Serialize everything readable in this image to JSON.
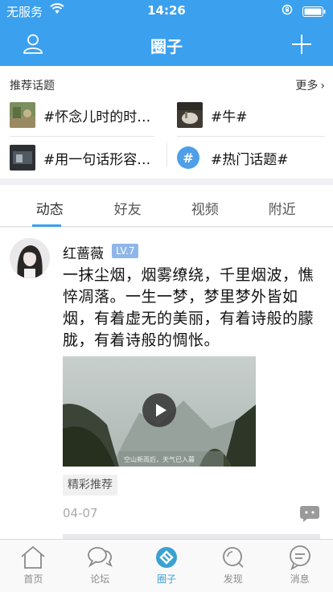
{
  "status_bar": {
    "carrier": "无服务",
    "time": "14:26"
  },
  "nav": {
    "title": "圈子",
    "user_icon": "user-icon",
    "add_icon": "plus-icon"
  },
  "topics": {
    "heading": "推荐话题",
    "more": "更多",
    "items": [
      {
        "label": "#怀念儿时的时…",
        "thumb": "photo-thumb"
      },
      {
        "label": "#牛#",
        "thumb": "photo-thumb"
      },
      {
        "label": "#用一句话形容…",
        "thumb": "photo-thumb"
      },
      {
        "label": "#热门话题#",
        "thumb": "hash-badge",
        "badge": "#"
      }
    ]
  },
  "tabs": {
    "active": 0,
    "items": [
      "动态",
      "好友",
      "视频",
      "附近"
    ]
  },
  "post": {
    "username": "红蔷薇",
    "level": "LV.7",
    "content": "一抹尘烟，烟雾缭绕，千里烟波，憔悴凋落。一生一梦，梦里梦外皆如烟，有着虚无的美丽，有着诗般的朦胧，有着诗般的惆怅。",
    "video_caption": "空山新雨后，天气已入暮",
    "tag": "精彩推荐",
    "date": "04-07"
  },
  "tabbar": {
    "active": 2,
    "items": [
      {
        "label": "首页",
        "icon": "home-icon"
      },
      {
        "label": "论坛",
        "icon": "chat-bubbles-icon"
      },
      {
        "label": "圈子",
        "icon": "circle-icon"
      },
      {
        "label": "发现",
        "icon": "search-icon"
      },
      {
        "label": "消息",
        "icon": "message-icon"
      }
    ]
  },
  "colors": {
    "accent": "#3ba0ee",
    "level_badge": "#8fb6e8",
    "tabbar_active": "#3aa2d0"
  }
}
